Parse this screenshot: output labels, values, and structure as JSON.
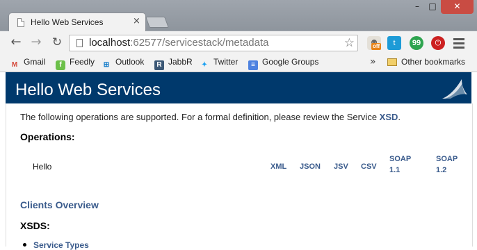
{
  "browser": {
    "tab_title": "Hello Web Services",
    "tab_close": "×",
    "window_controls": {
      "minimize": "–",
      "maximize": "□",
      "close": "✕"
    },
    "nav": {
      "back": "←",
      "forward": "→",
      "reload": "↻"
    },
    "url_host": "localhost",
    "url_rest": ":62577/servicestack/metadata",
    "star": "☆",
    "extensions": {
      "ext1_badge": "off",
      "twitter_ext": "t",
      "hangouts_ext": "99",
      "block_ext": "⏻"
    },
    "bookmarks": [
      {
        "label": "Gmail",
        "icon": "gmail-icon",
        "glyph": "M"
      },
      {
        "label": "Feedly",
        "icon": "feedly-icon",
        "glyph": "f"
      },
      {
        "label": "Outlook",
        "icon": "outlook-icon",
        "glyph": "⊞"
      },
      {
        "label": "JabbR",
        "icon": "jabbr-icon",
        "glyph": "R"
      },
      {
        "label": "Twitter",
        "icon": "twitter-icon",
        "glyph": "✦"
      },
      {
        "label": "Google Groups",
        "icon": "google-groups-icon",
        "glyph": "≡"
      }
    ],
    "more_bookmarks": "»",
    "other_bookmarks": "Other bookmarks"
  },
  "page": {
    "header_title": "Hello Web Services",
    "intro_text": "The following operations are supported. For a formal definition, please review the Service ",
    "intro_link": "XSD",
    "intro_end": ".",
    "operations_heading": "Operations:",
    "operation": {
      "name": "Hello",
      "formats": {
        "xml": "XML",
        "json": "JSON",
        "jsv": "JSV",
        "csv": "CSV",
        "soap11_a": "SOAP",
        "soap11_b": "1.1",
        "soap12_a": "SOAP",
        "soap12_b": "1.2"
      }
    },
    "clients_link": "Clients Overview",
    "xsds_heading": "XSDS:",
    "xsd_item": "Service Types"
  },
  "colors": {
    "header_bg": "#00396c",
    "link": "#3a5b8c"
  }
}
